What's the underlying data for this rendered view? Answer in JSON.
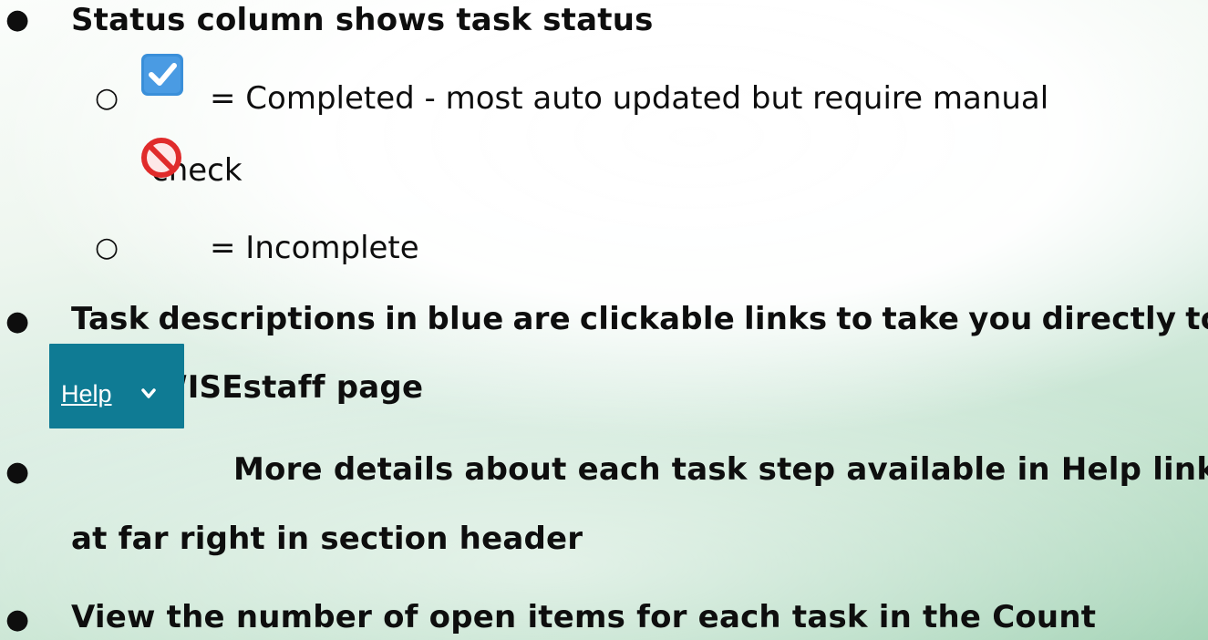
{
  "bullets": {
    "status": {
      "text": "Status column shows task status"
    },
    "completed": {
      "label": "= Completed - most auto updated but require manual",
      "continuation": "check"
    },
    "incomplete": {
      "label": "= Incomplete"
    },
    "links": {
      "line1": "Task descriptions  in blue are clickable links to take you directly to",
      "line2": "WISEstaff page"
    },
    "help_details": {
      "line1": "More details about each task step available in Help link",
      "line2": "at far right in section header"
    },
    "count": {
      "text": "View the number of open items for each task in the Count"
    }
  },
  "help_button": {
    "label": "Help",
    "icon": "chevron-down-icon"
  },
  "icons": {
    "completed": "checkbox-checked-icon",
    "incomplete": "no-entry-icon"
  },
  "colors": {
    "help_background": "#0f7b94",
    "checkbox_blue": "#3a8fd9",
    "prohibition_red": "#e02b2b"
  }
}
